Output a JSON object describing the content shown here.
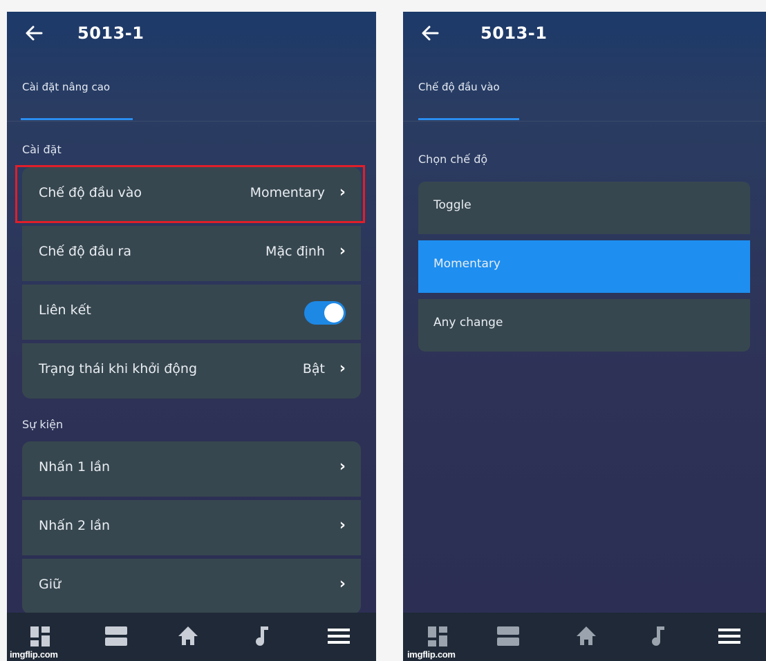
{
  "left": {
    "title": "5013-1",
    "tab": "Cài đặt nâng cao",
    "section_settings": "Cài đặt",
    "settings": [
      {
        "label": "Chế độ đầu vào",
        "value": "Momentary"
      },
      {
        "label": "Chế độ đầu ra",
        "value": "Mặc định"
      },
      {
        "label": "Liên kết",
        "toggle_on": true
      },
      {
        "label": "Trạng thái khi khởi động",
        "value": "Bật"
      }
    ],
    "section_events": "Sự kiện",
    "events": [
      {
        "label": "Nhấn 1 lần"
      },
      {
        "label": "Nhấn 2 lần"
      },
      {
        "label": "Giữ"
      }
    ],
    "watermark": "imgflip.com"
  },
  "right": {
    "title": "5013-1",
    "tab": "Chế độ đầu vào",
    "section": "Chọn chế độ",
    "options": [
      {
        "label": "Toggle",
        "selected": false
      },
      {
        "label": "Momentary",
        "selected": true
      },
      {
        "label": "Any change",
        "selected": false
      }
    ],
    "watermark": "imgflip.com"
  },
  "nav_icons": [
    "dashboard-icon",
    "list-icon",
    "home-icon",
    "music-icon",
    "menu-icon"
  ],
  "colors": {
    "accent": "#1e88e5",
    "selected_option": "#1e8ef0",
    "highlight_border": "#e01e2a",
    "card": "#37474f"
  }
}
